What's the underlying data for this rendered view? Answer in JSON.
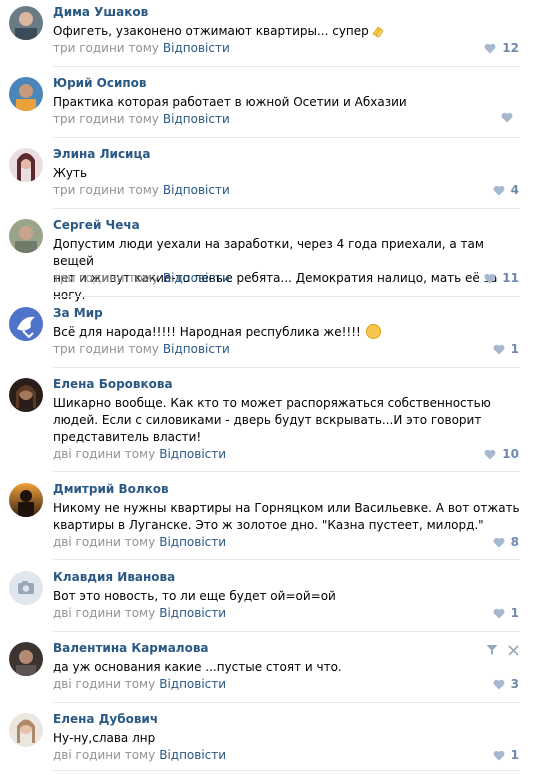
{
  "comments": [
    {
      "author": "Дима Ушаков",
      "text": "Офигеть, узаконено отжимают квартиры... супер",
      "time": "три години тому",
      "reply": "Відповісти",
      "likes": "12"
    },
    {
      "author": "Юрий Осипов",
      "text": "Практика которая работает в южной Осетии и Абхазии",
      "time": "три години тому",
      "reply": "Відповісти",
      "likes": ""
    },
    {
      "author": "Элина Лисица",
      "text": "Жуть",
      "time": "три години тому",
      "reply": "Відповісти",
      "likes": "4"
    },
    {
      "author": "Сергей Чеча",
      "text": "Допустим люди уехали на заработки, через 4 года приехали, а там вещей\nнет и живут какие-то левые ребята... Демократия налицо, мать её за ногу.",
      "time": "три години тому",
      "reply": "Відповісти",
      "likes": "11"
    },
    {
      "author": "За Мир",
      "text": "Всё для народа!!!!! Народная республика же!!!!",
      "time": "три години тому",
      "reply": "Відповісти",
      "likes": "1"
    },
    {
      "author": "Елена Боровкова",
      "text": "Шикарно вообще. Как кто то может распоряжаться собственностью\nлюдей. Если с силовиками - дверь будут вскрывать...И это говорит\nпредставитель власти!",
      "time": "дві години тому",
      "reply": "Відповісти",
      "likes": "10"
    },
    {
      "author": "Дмитрий Волков",
      "text": "Никому не нужны квартиры на Горняцком или Васильевке. А вот отжать\nквартиры в Луганске. Это ж золотое дно. \"Казна пустеет, милорд.\"",
      "time": "дві години тому",
      "reply": "Відповісти",
      "likes": "8"
    },
    {
      "author": "Клавдия Иванова",
      "text": "Вот это новость, то ли еще будет ой=ой=ой",
      "time": "дві години тому",
      "reply": "Відповісти",
      "likes": "1"
    },
    {
      "author": "Валентина Кармалова",
      "text": "да уж основания какие ...пустые стоят и что.",
      "time": "дві години тому",
      "reply": "Відповісти",
      "likes": "3"
    },
    {
      "author": "Елена Дубович",
      "text": "Ну-ну,слава лнр",
      "time": "дві години тому",
      "reply": "Відповісти",
      "likes": "1"
    }
  ],
  "colors": {
    "link": "#2a5885",
    "meta": "#939393",
    "like": "#6f89ad",
    "separator": "#e7e8ec"
  },
  "icons": {
    "like": "heart-icon",
    "filter": "filter-icon",
    "close": "close-icon",
    "camera": "camera-icon"
  }
}
